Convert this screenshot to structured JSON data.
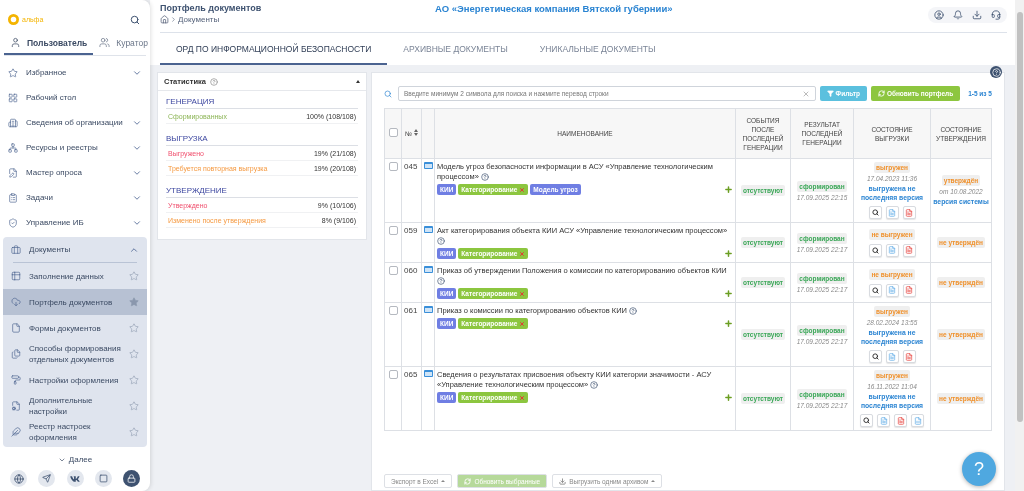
{
  "sidebar": {
    "logo": "альфа",
    "tabs": [
      {
        "label": "Пользователь",
        "selected": true
      },
      {
        "label": "Куратор",
        "selected": false
      }
    ],
    "items": [
      {
        "kind": "group",
        "label": "Избранное",
        "expanded": false
      },
      {
        "kind": "link",
        "label": "Рабочий стол"
      },
      {
        "kind": "group",
        "label": "Сведения об организации",
        "expanded": false
      },
      {
        "kind": "group",
        "label": "Ресурсы и реестры",
        "expanded": false
      },
      {
        "kind": "group",
        "label": "Мастер опроса",
        "expanded": false
      },
      {
        "kind": "group",
        "label": "Задачи",
        "expanded": false
      },
      {
        "kind": "group",
        "label": "Управление ИБ",
        "expanded": false
      },
      {
        "kind": "group",
        "label": "Документы",
        "expanded": true,
        "children": [
          {
            "label": "Заполнение данных",
            "selected": false,
            "starred": false
          },
          {
            "label": "Портфель документов",
            "selected": true,
            "starred": true
          },
          {
            "label": "Формы документов",
            "selected": false,
            "starred": false
          },
          {
            "label": "Способы формирования отдельных документов",
            "selected": false,
            "starred": false
          },
          {
            "label": "Настройки оформления",
            "selected": false,
            "starred": false
          },
          {
            "label": "Дополнительные настройки",
            "selected": false,
            "starred": false
          },
          {
            "label": "Реестр настроек оформления",
            "selected": false,
            "starred": false
          }
        ]
      }
    ],
    "more": "Далее"
  },
  "header": {
    "title": "Портфель документов",
    "breadcrumb": "Документы",
    "organization": "АО «Энергетическая компания Вятской губернии»"
  },
  "tabs": [
    {
      "label": "ОРД ПО ИНФОРМАЦИОННОЙ БЕЗОПАСНОСТИ",
      "selected": true
    },
    {
      "label": "АРХИВНЫЕ ДОКУМЕНТЫ",
      "selected": false
    },
    {
      "label": "УНИКАЛЬНЫЕ ДОКУМЕНТЫ",
      "selected": false
    }
  ],
  "stats": {
    "title": "Статистика",
    "expanded": true,
    "sections": [
      {
        "heading": "ГЕНЕРАЦИЯ",
        "rows": [
          {
            "label": "Сформированных",
            "value": "100% (108/108)",
            "kind": "success"
          }
        ]
      },
      {
        "heading": "ВЫГРУЗКА",
        "rows": [
          {
            "label": "Выгружено",
            "value": "19% (21/108)",
            "kind": "danger"
          },
          {
            "label": "Требуется повторная выгрузка",
            "value": "19% (20/108)",
            "kind": "warning"
          }
        ]
      },
      {
        "heading": "УТВЕРЖДЕНИЕ",
        "rows": [
          {
            "label": "Утверждено",
            "value": "9% (10/106)",
            "kind": "danger"
          },
          {
            "label": "Изменено после утверждения",
            "value": "8% (9/106)",
            "kind": "warning"
          }
        ]
      }
    ]
  },
  "toolbar": {
    "search_placeholder": "Введите минимум 2 символа для поиска и нажмите перевод строки",
    "filter": "Фильтр",
    "refresh": "Обновить портфель",
    "count": "1-5 из 5"
  },
  "table": {
    "select_all_checked": false,
    "columns": [
      {
        "label": "№",
        "sortable": true
      },
      {
        "label": "НАИМЕНОВАНИЕ",
        "sortable": false
      },
      {
        "label": "СОБЫТИЯ ПОСЛЕ ПОСЛЕДНЕЙ ГЕНЕРАЦИИ",
        "sortable": false
      },
      {
        "label": "РЕЗУЛЬТАТ ПОСЛЕДНЕЙ ГЕНЕРАЦИИ",
        "sortable": false
      },
      {
        "label": "СОСТОЯНИЕ ВЫГРУЗКИ",
        "sortable": false
      },
      {
        "label": "СОСТОЯНИЕ УТВЕРЖДЕНИЯ",
        "sortable": false
      }
    ],
    "rows": [
      {
        "checked": false,
        "number": "045",
        "title": "Модель угроз безопасности информации в АСУ «Управление технологическим процессом»",
        "tags": [
          {
            "label": "КИИ",
            "color": "#6f7ee3",
            "removable": false
          },
          {
            "label": "Категорирование",
            "color": "#8cc63f",
            "removable": true
          },
          {
            "label": "Модель угроз",
            "color": "#6f7ee3",
            "removable": false
          }
        ],
        "events": "отсутствуют",
        "result": {
          "label": "сформирован",
          "date": "17.09.2025 22:15"
        },
        "upload": {
          "label": "выгружен",
          "date": "17.04.2023 11:36",
          "note": "выгружена не последняя версия"
        },
        "files": [
          {
            "kind": "view"
          },
          {
            "kind": "word"
          },
          {
            "kind": "pdf"
          }
        ],
        "approval": {
          "label": "утверждён",
          "date": "от 10.08.2022",
          "note": "версия системы"
        }
      },
      {
        "checked": false,
        "number": "059",
        "title": "Акт категорирования объекта КИИ АСУ «Управление технологическим процессом»",
        "tags": [
          {
            "label": "КИИ",
            "color": "#6f7ee3",
            "removable": false
          },
          {
            "label": "Категорирование",
            "color": "#8cc63f",
            "removable": true
          }
        ],
        "events": "отсутствуют",
        "result": {
          "label": "сформирован",
          "date": "17.09.2025 22:17"
        },
        "upload": {
          "label": "не выгружен"
        },
        "files": [
          {
            "kind": "view"
          },
          {
            "kind": "word"
          },
          {
            "kind": "pdf"
          }
        ],
        "approval": {
          "label": "не утверждён"
        }
      },
      {
        "checked": false,
        "number": "060",
        "title": "Приказ об утверждении Положения о комиссии по категорированию объектов КИИ",
        "tags": [
          {
            "label": "КИИ",
            "color": "#6f7ee3",
            "removable": false
          },
          {
            "label": "Категорирование",
            "color": "#8cc63f",
            "removable": true
          }
        ],
        "events": "отсутствуют",
        "result": {
          "label": "сформирован",
          "date": "17.09.2025 22:17"
        },
        "upload": {
          "label": "не выгружен"
        },
        "files": [
          {
            "kind": "view"
          },
          {
            "kind": "word"
          },
          {
            "kind": "pdf"
          }
        ],
        "approval": {
          "label": "не утверждён"
        }
      },
      {
        "checked": false,
        "number": "061",
        "title": "Приказ о комиссии по категорированию объектов КИИ",
        "tags": [
          {
            "label": "КИИ",
            "color": "#6f7ee3",
            "removable": false
          },
          {
            "label": "Категорирование",
            "color": "#8cc63f",
            "removable": true
          }
        ],
        "events": "отсутствуют",
        "result": {
          "label": "сформирован",
          "date": "17.09.2025 22:17"
        },
        "upload": {
          "label": "выгружен",
          "date": "28.02.2024 13:55",
          "note": "выгружена не последняя версия"
        },
        "files": [
          {
            "kind": "view"
          },
          {
            "kind": "word"
          },
          {
            "kind": "pdf"
          }
        ],
        "approval": {
          "label": "не утверждён"
        }
      },
      {
        "checked": false,
        "number": "065",
        "title": "Сведения о результатах присвоения объекту КИИ категории значимости - АСУ «Управление технологическим процессом»",
        "tags": [
          {
            "label": "КИИ",
            "color": "#6f7ee3",
            "removable": false
          },
          {
            "label": "Категорирование",
            "color": "#8cc63f",
            "removable": true
          }
        ],
        "events": "отсутствуют",
        "result": {
          "label": "сформирован",
          "date": "17.09.2025 22:17"
        },
        "upload": {
          "label": "выгружен",
          "date": "16.11.2022 11:04",
          "note": "выгружена не последняя версия"
        },
        "files": [
          {
            "kind": "view"
          },
          {
            "kind": "word"
          },
          {
            "kind": "pdf"
          },
          {
            "kind": "excel"
          }
        ],
        "approval": {
          "label": "не утверждён"
        }
      }
    ]
  },
  "footer_buttons": [
    {
      "kind": "dropdown",
      "label": "Экспорт в Excel",
      "disabled": false
    },
    {
      "kind": "refresh",
      "label": "Обновить выбранные",
      "disabled": true
    },
    {
      "kind": "download",
      "label": "Выгрузить одним архивом",
      "disabled": false
    }
  ],
  "help": "?"
}
